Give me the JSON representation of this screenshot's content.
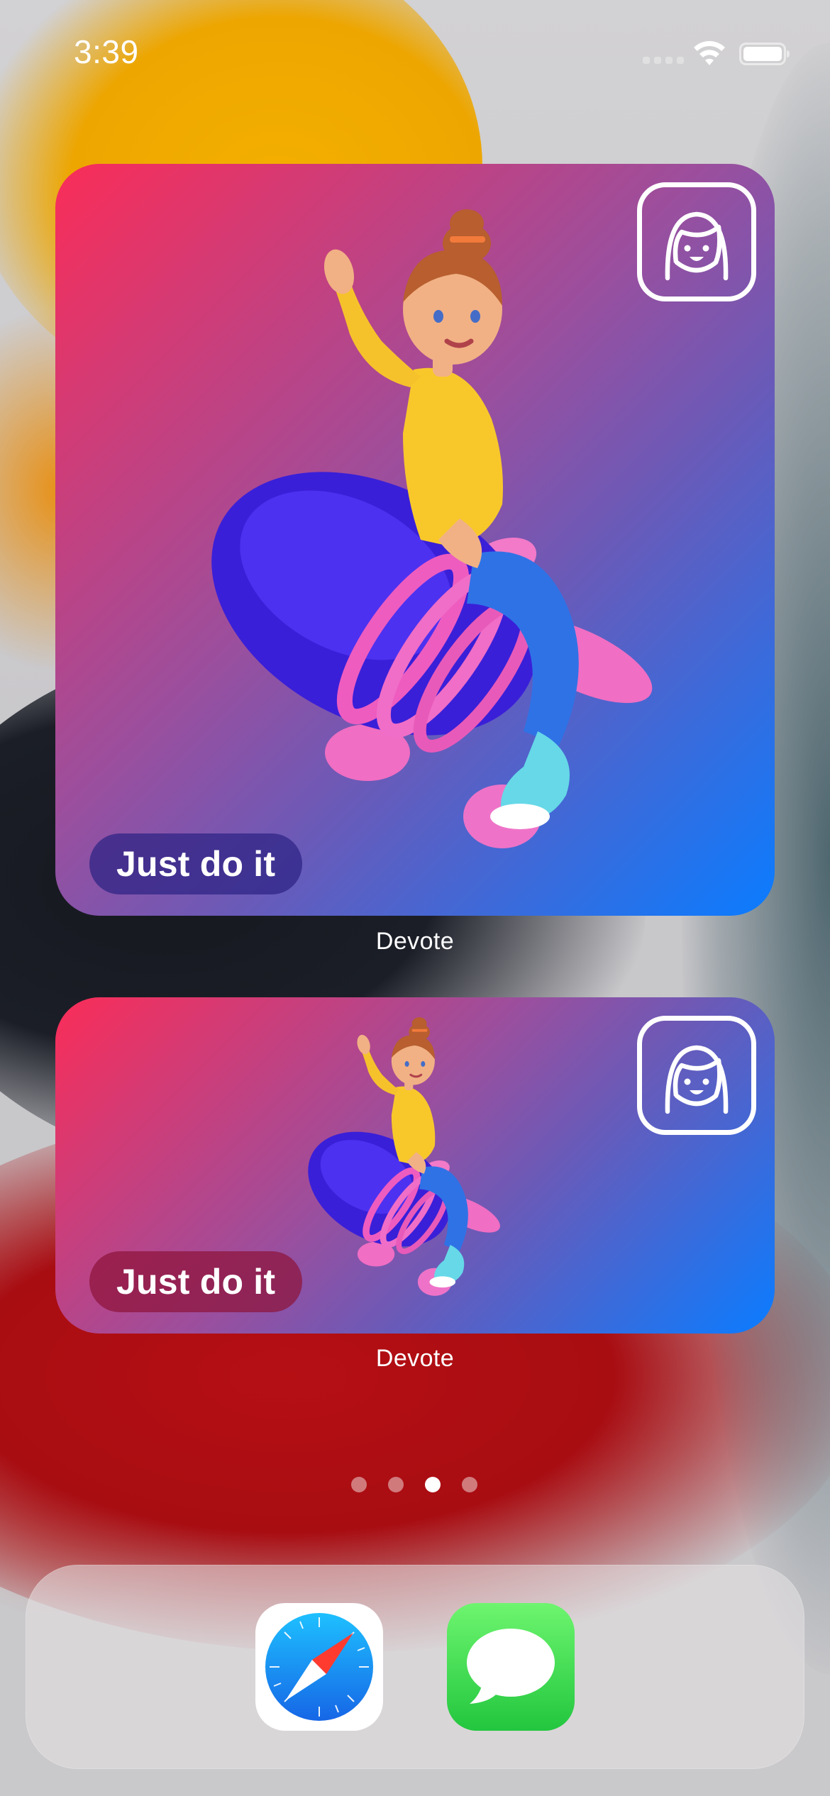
{
  "status_bar": {
    "time": "3:39"
  },
  "widgets": [
    {
      "quote": "Just do it",
      "app_label": "Devote",
      "size": "large"
    },
    {
      "quote": "Just do it",
      "app_label": "Devote",
      "size": "medium"
    }
  ],
  "page_indicator": {
    "pages": 4,
    "current_page": 3
  },
  "dock": {
    "apps": [
      {
        "icon": "safari-icon"
      },
      {
        "icon": "messages-icon"
      }
    ]
  },
  "colors": {
    "widget_gradient_start": "#fa2d58",
    "widget_gradient_end": "#0a7cff",
    "large_pill": "#2c2284",
    "medium_pill": "#8d143a"
  }
}
